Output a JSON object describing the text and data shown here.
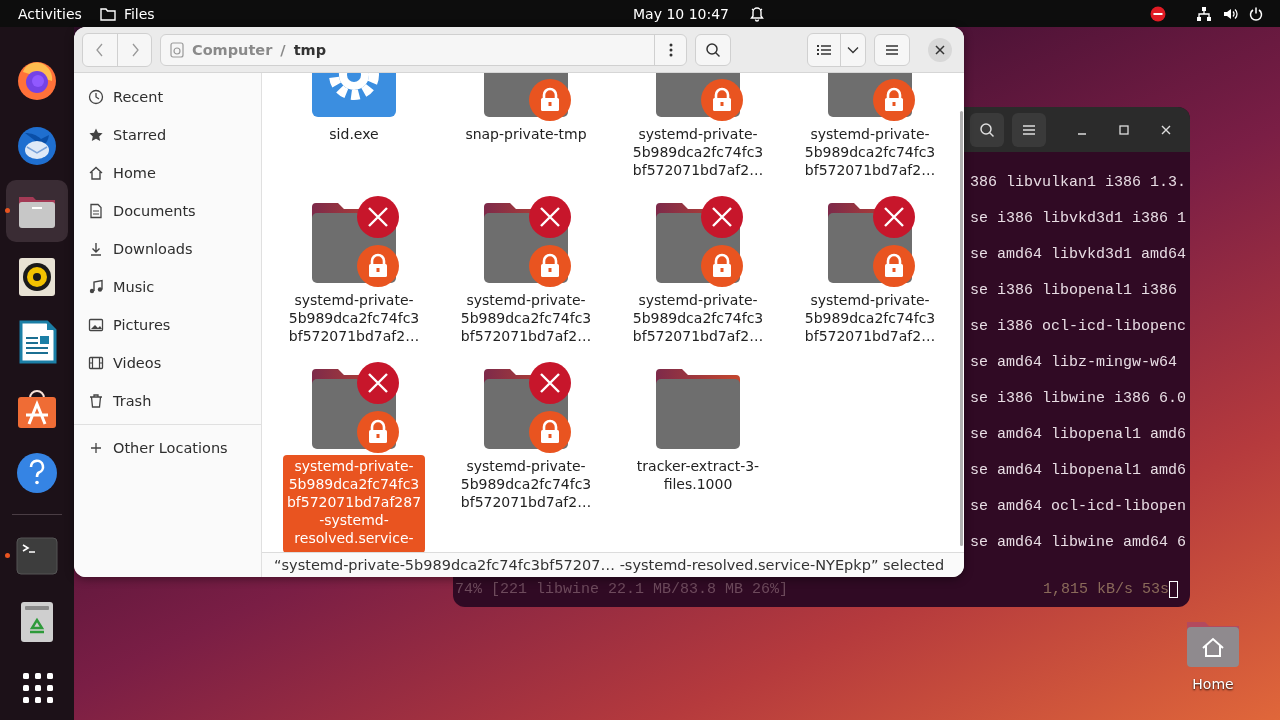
{
  "top_bar": {
    "activities": "Activities",
    "app": "Files",
    "clock": "May 10  10:47"
  },
  "dock": [
    {
      "kind": "firefox",
      "running": false,
      "active": false
    },
    {
      "kind": "thunderbird",
      "running": false,
      "active": false
    },
    {
      "kind": "files",
      "running": true,
      "active": true
    },
    {
      "kind": "rhythmbox",
      "running": false,
      "active": false
    },
    {
      "kind": "writer",
      "running": false,
      "active": false
    },
    {
      "kind": "appcenter",
      "running": false,
      "active": false
    },
    {
      "kind": "help",
      "running": false,
      "active": false
    },
    {
      "kind": "separator"
    },
    {
      "kind": "terminal",
      "running": true,
      "active": false
    },
    {
      "kind": "trash",
      "running": false,
      "active": false
    },
    {
      "kind": "apps",
      "running": false,
      "active": false
    }
  ],
  "terminal": {
    "lines": [
      "386 libvulkan1 i386 1.3.",
      "se i386 libvkd3d1 i386 1",
      "se amd64 libvkd3d1 amd64",
      "se i386 libopenal1 i386",
      "se i386 ocl-icd-libopenc",
      "se amd64 libz-mingw-w64",
      "se i386 libwine i386 6.0",
      "se amd64 libopenal1 amd6",
      "se amd64 libopenal1 amd6",
      "se amd64 ocl-icd-libopen",
      "se amd64 libwine amd64 6"
    ],
    "progress": "74% [221 libwine 22.1 MB/83.8 MB 26%]",
    "rate": "1,815 kB/s 53s"
  },
  "files_window": {
    "path": [
      {
        "kind": "crumb",
        "text": "Computer"
      },
      {
        "kind": "separator",
        "text": "/"
      },
      {
        "kind": "crumb",
        "text": "tmp"
      }
    ],
    "sidebar": [
      {
        "label": "Recent"
      },
      {
        "label": "Starred"
      },
      {
        "label": "Home"
      },
      {
        "label": "Documents"
      },
      {
        "label": "Downloads"
      },
      {
        "label": "Music"
      },
      {
        "label": "Pictures"
      },
      {
        "label": "Videos"
      },
      {
        "label": "Trash"
      }
    ],
    "other_locations": "Other Locations",
    "items": [
      {
        "kind": "executable",
        "label_lines": [
          "sid.exe"
        ],
        "locked": false,
        "unreadable": false,
        "selected": false
      },
      {
        "kind": "folder",
        "label_lines": [
          "snap-private-tmp"
        ],
        "locked": true,
        "unreadable": false,
        "selected": false
      },
      {
        "kind": "folder",
        "label_lines": [
          "systemd-private-",
          "5b989dca2fc74fc3",
          "bf572071bd7af2…"
        ],
        "locked": true,
        "unreadable": false,
        "selected": false
      },
      {
        "kind": "folder",
        "label_lines": [
          "systemd-private-",
          "5b989dca2fc74fc3",
          "bf572071bd7af2…"
        ],
        "locked": true,
        "unreadable": false,
        "selected": false
      },
      {
        "kind": "folder",
        "label_lines": [
          "systemd-private-",
          "5b989dca2fc74fc3",
          "bf572071bd7af2…"
        ],
        "locked": true,
        "unreadable": true,
        "selected": false
      },
      {
        "kind": "folder",
        "label_lines": [
          "systemd-private-",
          "5b989dca2fc74fc3",
          "bf572071bd7af2…"
        ],
        "locked": true,
        "unreadable": true,
        "selected": false
      },
      {
        "kind": "folder",
        "label_lines": [
          "systemd-private-",
          "5b989dca2fc74fc3",
          "bf572071bd7af2…"
        ],
        "locked": true,
        "unreadable": true,
        "selected": false
      },
      {
        "kind": "folder",
        "label_lines": [
          "systemd-private-",
          "5b989dca2fc74fc3",
          "bf572071bd7af2…"
        ],
        "locked": true,
        "unreadable": true,
        "selected": false
      },
      {
        "kind": "folder",
        "label_lines": [
          "systemd-private-",
          "5b989dca2fc74fc3",
          "bf572071bd7af287",
          "-systemd-",
          "resolved.service-"
        ],
        "locked": true,
        "unreadable": true,
        "selected": true
      },
      {
        "kind": "folder",
        "label_lines": [
          "systemd-private-",
          "5b989dca2fc74fc3",
          "bf572071bd7af2…"
        ],
        "locked": true,
        "unreadable": true,
        "selected": false
      },
      {
        "kind": "folder",
        "label_lines": [
          "tracker-extract-3-",
          "files.1000"
        ],
        "locked": false,
        "unreadable": false,
        "selected": false
      }
    ],
    "status": "“systemd-private-5b989dca2fc74fc3bf57207…  -systemd-resolved.service-NYEpkp” selected"
  },
  "desktop_icons": [
    {
      "label": "Home"
    }
  ]
}
